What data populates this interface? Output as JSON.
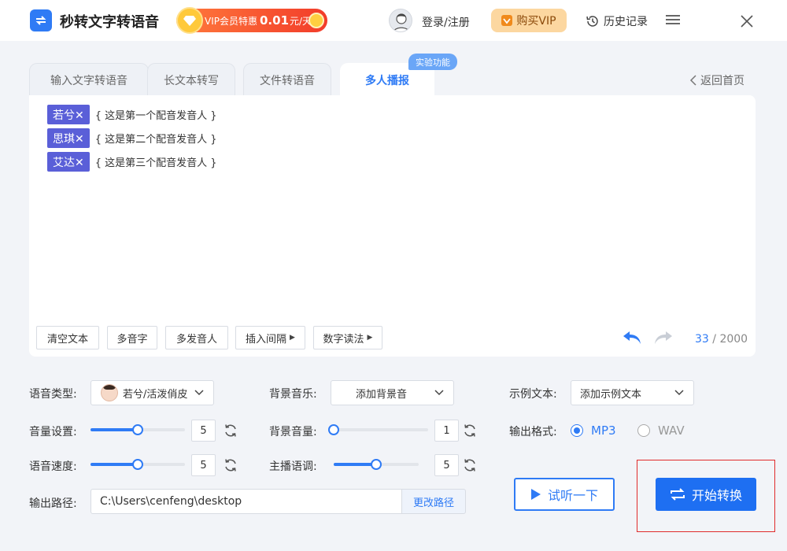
{
  "header": {
    "app_title": "秒转文字转语音",
    "vip_promo": {
      "prefix": "VIP会员特惠",
      "price": "0.01",
      "suffix": "元/天"
    },
    "login_label": "登录/注册",
    "buy_vip_label": "购买VIP",
    "history_label": "历史记录"
  },
  "tabs": [
    {
      "label": "输入文字转语音",
      "active": false
    },
    {
      "label": "长文本转写",
      "active": false
    },
    {
      "label": "文件转语音",
      "active": false
    },
    {
      "label": "多人播报",
      "active": true
    }
  ],
  "tab_badge": "实验功能",
  "back_home_label": "返回首页",
  "editor": {
    "speakers": [
      {
        "tag": "若兮✕",
        "text": "{ 这是第一个配音发音人 }"
      },
      {
        "tag": "思琪✕",
        "text": "{ 这是第二个配音发音人 }"
      },
      {
        "tag": "艾达✕",
        "text": "{ 这是第三个配音发音人 }"
      }
    ],
    "toolbar": {
      "clear": "清空文本",
      "polyphone": "多音字",
      "multi_speaker": "多发音人",
      "insert_pause": "插入间隔",
      "number_reading": "数字读法"
    },
    "char_count": {
      "current": "33",
      "separator": " / ",
      "max": "2000"
    }
  },
  "settings": {
    "voice_type": {
      "label": "语音类型:",
      "value": "若兮/活泼俏皮"
    },
    "bg_music": {
      "label": "背景音乐:",
      "value": "添加背景音"
    },
    "sample_text": {
      "label": "示例文本:",
      "value": "添加示例文本"
    },
    "volume": {
      "label": "音量设置:",
      "value": "5",
      "level": 0.5
    },
    "bg_volume": {
      "label": "背景音量:",
      "value": "1",
      "level": 0.0
    },
    "output_format": {
      "label": "输出格式:",
      "options": [
        "MP3",
        "WAV"
      ],
      "selected": "MP3"
    },
    "speed": {
      "label": "语音速度:",
      "value": "5",
      "level": 0.5
    },
    "pitch": {
      "label": "主播语调:",
      "value": "5",
      "level": 0.5
    },
    "output_path": {
      "label": "输出路径:",
      "value": "C:\\Users\\cenfeng\\desktop",
      "change_label": "更改路径"
    }
  },
  "actions": {
    "preview": "试听一下",
    "start": "开始转换"
  },
  "colors": {
    "accent": "#2f7bf5",
    "speaker_tag": "#5a5fd8",
    "highlight": "#e02b2b"
  }
}
